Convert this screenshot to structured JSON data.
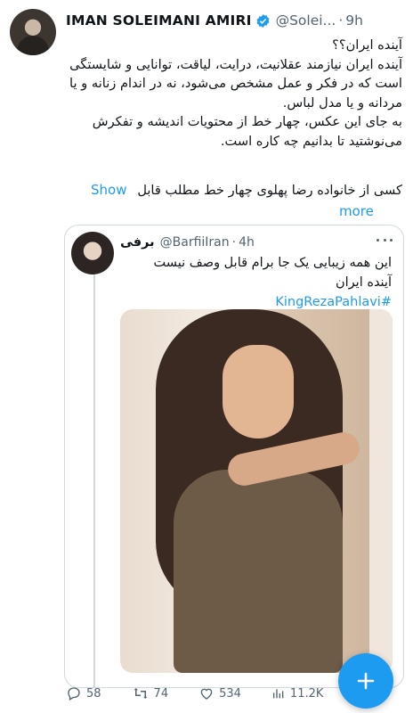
{
  "author": {
    "name": "IMAN SOLEIMANI AMIRI",
    "handle": "@Solei...",
    "dot": "·",
    "time": "9h"
  },
  "tweet": {
    "lines": [
      "آینده ایران؟؟",
      "آینده ایران نیازمند عقلانیت، درایت، لیاقت، توانایی و شایستگی است که در فکر و عمل مشخص می‌شود، نه در اندام زنانه و یا مردانه و یا مدل لباس.",
      "به جای این عکس، چهار خط از محتویات اندیشه و تفکرش می‌نوشتید تا بدانیم چه کاره است."
    ],
    "last_line": "کسی از خانواده رضا پهلوی چهار خط مطلب قابل",
    "show_more_1": "Show",
    "show_more_2": "more"
  },
  "quote": {
    "name": "برفی",
    "handle": "@BarfiiIran",
    "dot": "·",
    "time": "4h",
    "line1": "این همه زیبایی یک جا برام قابل وصف نیست",
    "line2": "آینده ایران",
    "hashtag": "#KingRezaPahlavi"
  },
  "actions": {
    "replies": "58",
    "retweets": "74",
    "likes": "534",
    "views": "11.2K"
  },
  "colors": {
    "accent": "#1d9bf0",
    "muted": "#536471",
    "border": "#cfd9de"
  }
}
